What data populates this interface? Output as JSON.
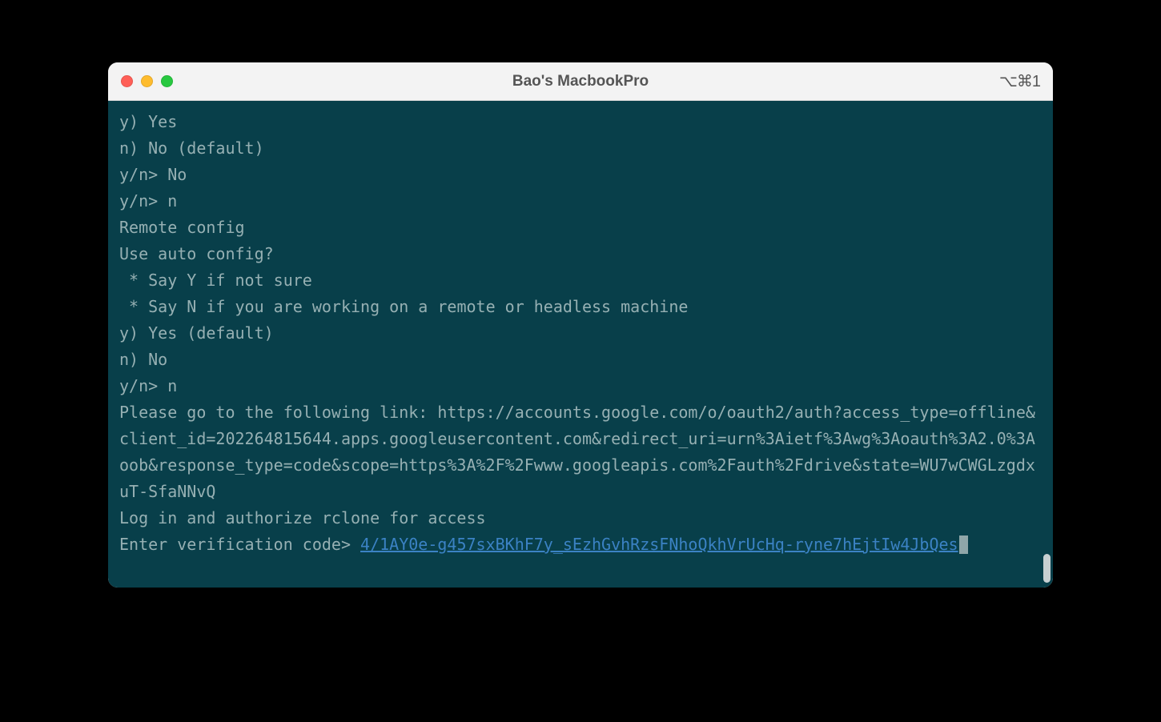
{
  "titlebar": {
    "title": "Bao's MacbookPro",
    "right": "⌥⌘1"
  },
  "terminal": {
    "lines": [
      "y) Yes",
      "n) No (default)",
      "y/n> No",
      "y/n> n",
      "Remote config",
      "Use auto config?",
      " * Say Y if not sure",
      " * Say N if you are working on a remote or headless machine",
      "y) Yes (default)",
      "n) No",
      "y/n> n"
    ],
    "oauth_prefix": "Please go to the following link: ",
    "oauth_url": "https://accounts.google.com/o/oauth2/auth?access_type=offline&client_id=202264815644.apps.googleusercontent.com&redirect_uri=urn%3Aietf%3Awg%3Aoauth%3A2.0%3Aoob&response_type=code&scope=https%3A%2F%2Fwww.googleapis.com%2Fauth%2Fdrive&state=WU7wCWGLzgdxuT-SfaNNvQ",
    "authorize_line": "Log in and authorize rclone for access",
    "verif_prompt": "Enter verification code> ",
    "verif_code": "4/1AY0e-g457sxBKhF7y_sEzhGvhRzsFNhoQkhVrUcHq-ryne7hEjtIw4JbQes"
  }
}
